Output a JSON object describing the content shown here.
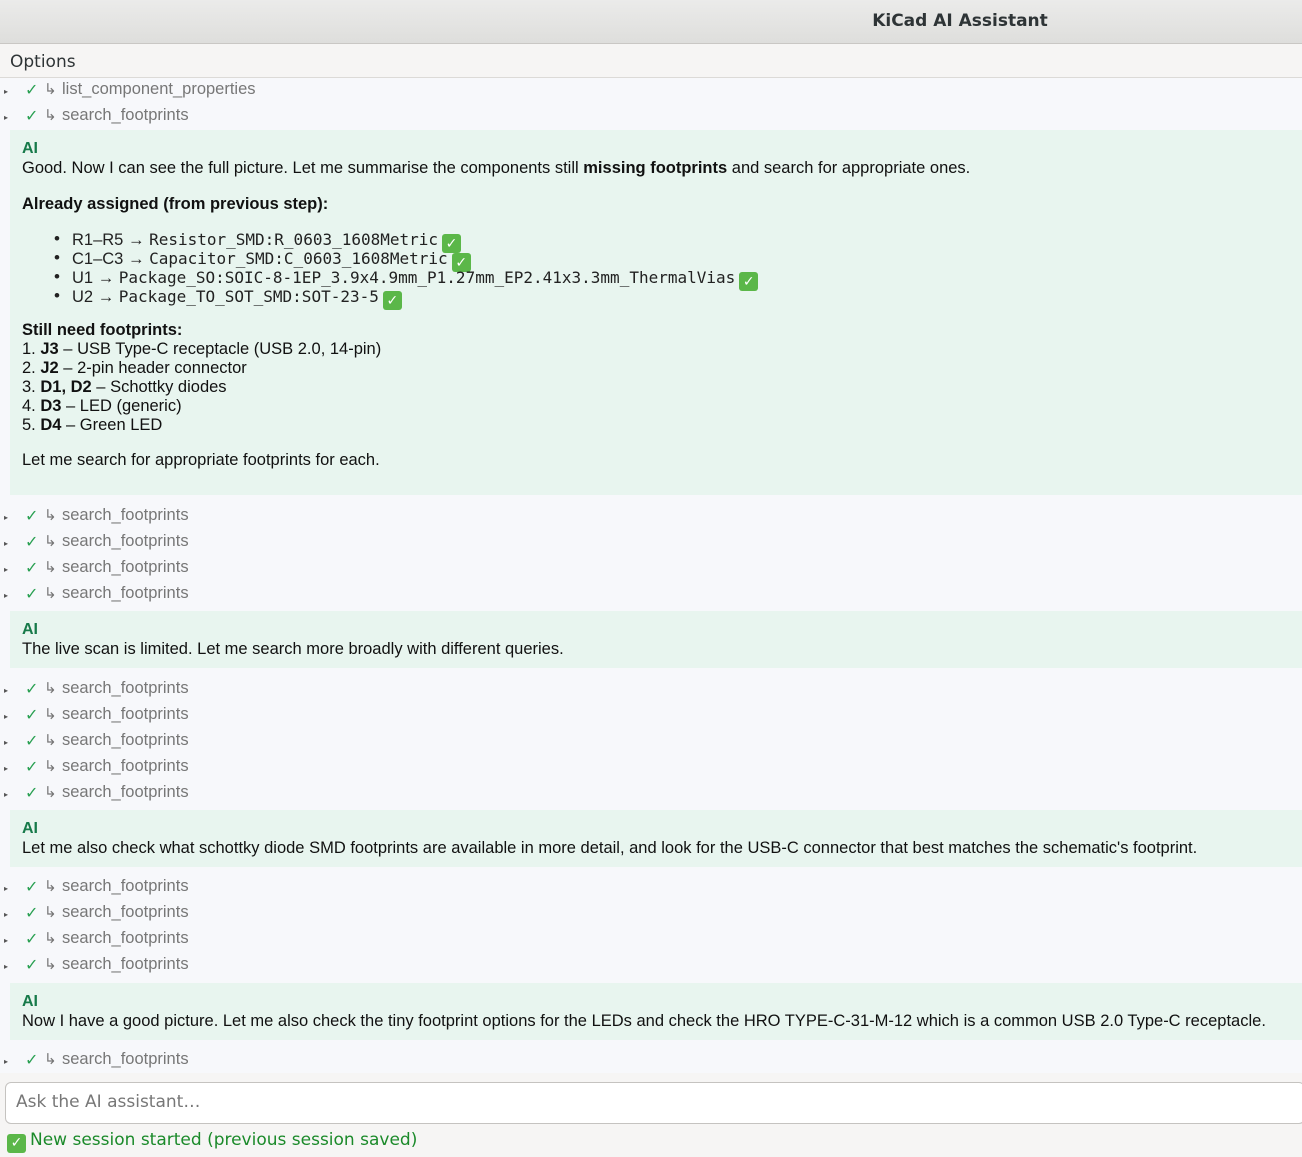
{
  "window": {
    "title": "KiCad AI Assistant"
  },
  "menu": {
    "options": "Options"
  },
  "tool_check": "✓",
  "tool_prefix": "↳",
  "ai_label": "AI",
  "tools": [
    "list_component_properties",
    "search_footprints",
    "search_footprints",
    "search_footprints",
    "search_footprints",
    "search_footprints",
    "search_footprints",
    "search_footprints",
    "search_footprints",
    "search_footprints",
    "search_footprints",
    "search_footprints",
    "search_footprints",
    "search_footprints",
    "search_footprints",
    "search_footprints"
  ],
  "msg1": {
    "intro_a": "Good. Now I can see the full picture. Let me summarise the components still ",
    "intro_bold": "missing footprints",
    "intro_b": " and search for appropriate ones.",
    "assigned_heading": "Already assigned (from previous step):",
    "assigned": [
      {
        "refs": "R1–R5",
        "arrow": "→",
        "fp": "Resistor_SMD:R_0603_1608Metric"
      },
      {
        "refs": "C1–C3",
        "arrow": "→",
        "fp": "Capacitor_SMD:C_0603_1608Metric"
      },
      {
        "refs": "U1",
        "arrow": "→",
        "fp": "Package_SO:SOIC-8-1EP_3.9x4.9mm_P1.27mm_EP2.41x3.3mm_ThermalVias"
      },
      {
        "refs": "U2",
        "arrow": "→",
        "fp": "Package_TO_SOT_SMD:SOT-23-5"
      }
    ],
    "need_heading": "Still need footprints:",
    "needs": [
      {
        "num": "1.",
        "ref": "J3",
        "desc": " – USB Type-C receptacle (USB 2.0, 14-pin)"
      },
      {
        "num": "2.",
        "ref": "J2",
        "desc": " – 2-pin header connector"
      },
      {
        "num": "3.",
        "ref": "D1, D2",
        "desc": " – Schottky diodes"
      },
      {
        "num": "4.",
        "ref": "D3",
        "desc": " – LED (generic)"
      },
      {
        "num": "5.",
        "ref": "D4",
        "desc": " – Green LED"
      }
    ],
    "outro": "Let me search for appropriate footprints for each."
  },
  "msg2": "The live scan is limited. Let me search more broadly with different queries.",
  "msg3": "Let me also check what schottky diode SMD footprints are available in more detail, and look for the USB-C connector that best matches the schematic's footprint.",
  "msg4": "Now I have a good picture. Let me also check the tiny footprint options for the LEDs and check the HRO TYPE-C-31-M-12 which is a common USB 2.0 Type-C receptacle.",
  "input": {
    "placeholder": "Ask the AI assistant…"
  },
  "status": {
    "icon": "✓",
    "text": "New session started (previous session saved)"
  },
  "icons": {
    "done": "check-mark-icon",
    "ok": "green-check-emoji-icon",
    "expand": "expand-triangle-icon"
  },
  "colors": {
    "ai_bg": "#e8f5ef",
    "ai_label": "#177a4a",
    "check": "#2aa052",
    "status": "#1b8a2a"
  }
}
